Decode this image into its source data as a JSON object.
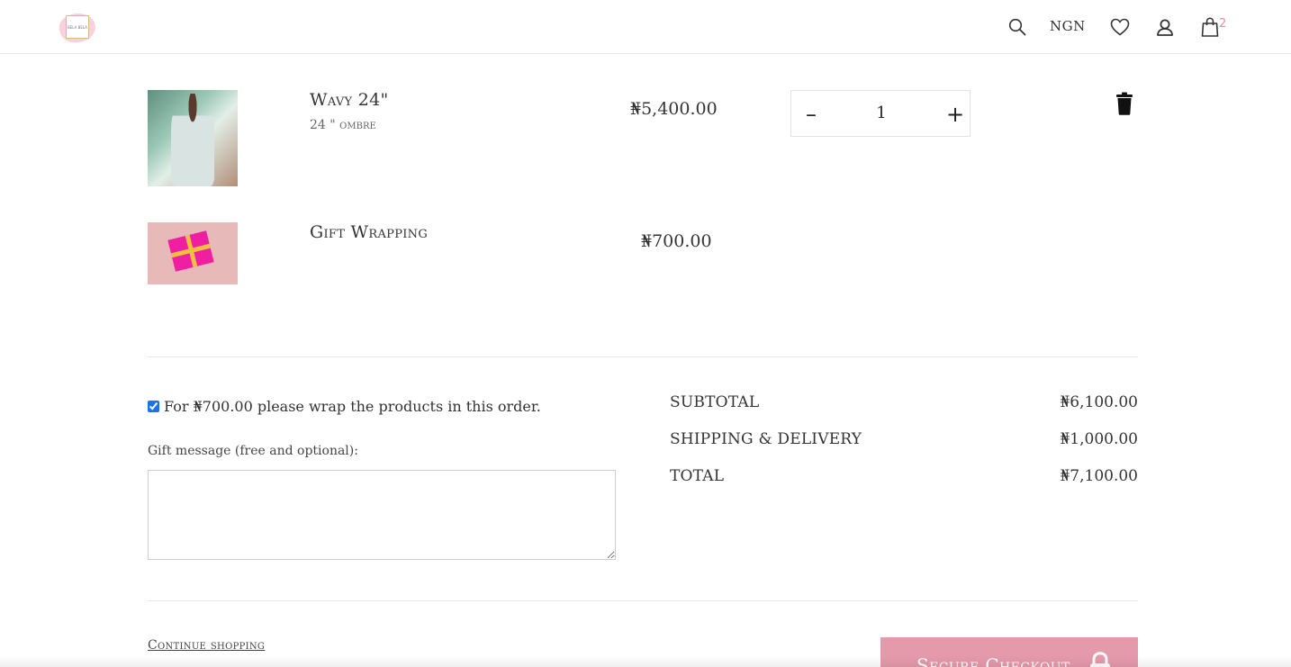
{
  "header": {
    "logo_text": "BELA BELA",
    "currency": "NGN",
    "cart_count": "2",
    "icons": [
      "search-icon",
      "heart-icon",
      "user-icon",
      "bag-icon"
    ]
  },
  "cart": {
    "items": [
      {
        "name": "Wavy 24\"",
        "variant": "24 \" ombre",
        "price": "₦5,400.00",
        "quantity": "1"
      },
      {
        "name": "Gift Wrapping",
        "price": "₦700.00"
      }
    ]
  },
  "gift": {
    "wrap_label": "For ₦700.00 please wrap the products in this order.",
    "wrap_checked": true,
    "message_label": "Gift message (free and optional):",
    "message_value": ""
  },
  "summary": {
    "subtotal_label": "SUBTOTAL",
    "subtotal_value": "₦6,100.00",
    "shipping_label": "SHIPPING & DELIVERY",
    "shipping_value": "₦1,000.00",
    "total_label": "TOTAL",
    "total_value": "₦7,100.00"
  },
  "actions": {
    "continue_label": "Continue shopping",
    "checkout_label": "Secure Checkout"
  },
  "colors": {
    "accent": "#e59aab",
    "cart_badge": "#e78ba0",
    "checkbox": "#1a73e8"
  }
}
